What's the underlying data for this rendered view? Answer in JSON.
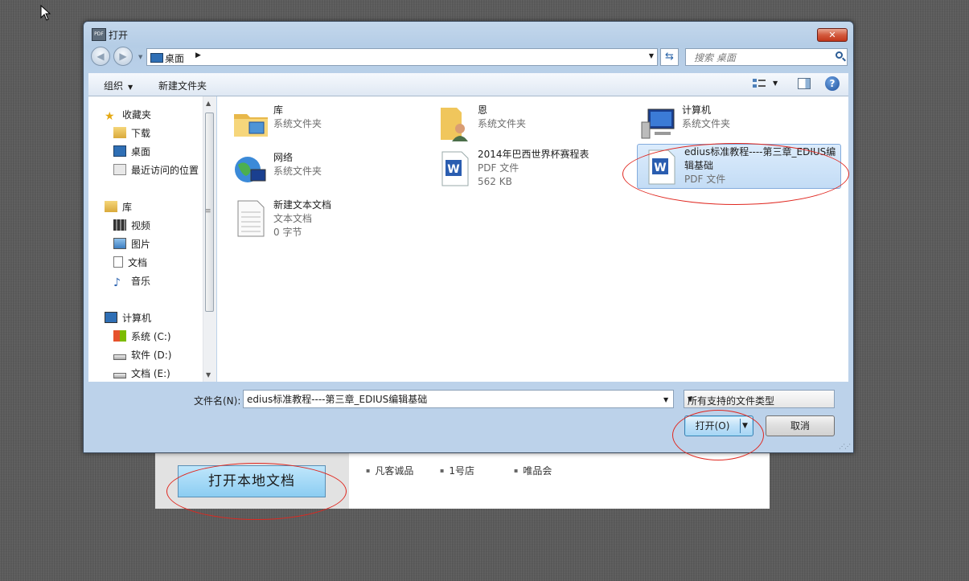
{
  "dialog": {
    "title": "打开",
    "app_icon_label": "PDF",
    "address": {
      "location": "桌面"
    },
    "search": {
      "placeholder": "搜索 桌面"
    },
    "toolbar": {
      "organize": "组织",
      "new_folder": "新建文件夹"
    },
    "nav": {
      "favorites": "收藏夹",
      "downloads": "下载",
      "desktop": "桌面",
      "recent": "最近访问的位置",
      "libraries": "库",
      "videos": "视频",
      "pictures": "图片",
      "documents": "文档",
      "music": "音乐",
      "computer": "计算机",
      "drive_c": "系统 (C:)",
      "drive_d": "软件 (D:)",
      "drive_e": "文档 (E:)"
    },
    "files": [
      {
        "name": "库",
        "meta1": "系统文件夹",
        "meta2": "",
        "icon": "library-folder-icon"
      },
      {
        "name": "恩",
        "meta1": "系统文件夹",
        "meta2": "",
        "icon": "user-folder-icon"
      },
      {
        "name": "计算机",
        "meta1": "系统文件夹",
        "meta2": "",
        "icon": "computer-icon"
      },
      {
        "name": "网络",
        "meta1": "系统文件夹",
        "meta2": "",
        "icon": "network-icon"
      },
      {
        "name": "2014年巴西世界杯赛程表",
        "meta1": "PDF 文件",
        "meta2": "562 KB",
        "icon": "pdf-doc-icon"
      },
      {
        "name": "edius标准教程----第三章_EDIUS编辑基础",
        "meta1": "PDF 文件",
        "meta2": "",
        "icon": "pdf-doc-icon"
      },
      {
        "name": "新建文本文档",
        "meta1": "文本文档",
        "meta2": "0 字节",
        "icon": "text-doc-icon"
      }
    ],
    "filename_label": "文件名(N):",
    "filename_value": "edius标准教程----第三章_EDIUS编辑基础",
    "file_type": "所有支持的文件类型",
    "open_button": "打开(O)",
    "cancel_button": "取消"
  },
  "page": {
    "open_local_button": "打开本地文档",
    "shops": [
      "凡客诚品",
      "1号店",
      "唯品会"
    ]
  },
  "colors": {
    "annotation_red": "#e0271f",
    "selection_blue": "#c3dcf5",
    "dialog_frame": "#bcd2ea"
  }
}
